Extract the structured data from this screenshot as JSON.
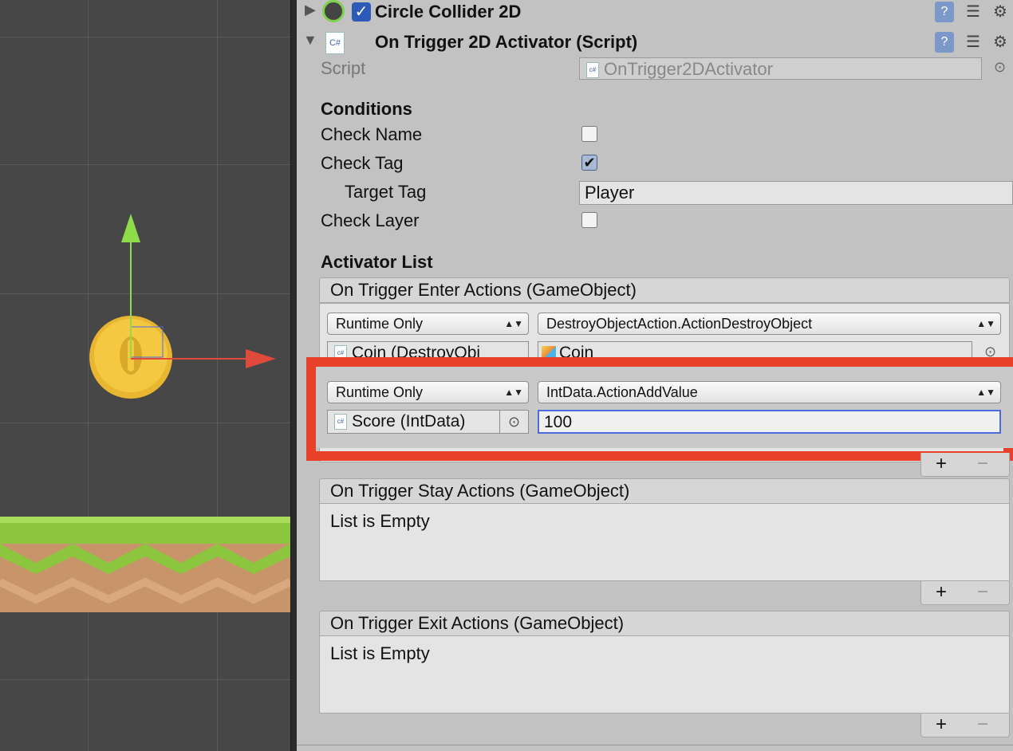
{
  "components": {
    "circle_collider": {
      "title": "Circle Collider 2D"
    },
    "script_component": {
      "title": "On Trigger 2D Activator (Script)",
      "badge": "C#"
    }
  },
  "script_row": {
    "label": "Script",
    "value": "OnTrigger2DActivator"
  },
  "conditions": {
    "header": "Conditions",
    "check_name": {
      "label": "Check Name",
      "checked": false
    },
    "check_tag": {
      "label": "Check Tag",
      "checked": true
    },
    "target_tag": {
      "label": "Target Tag",
      "value": "Player"
    },
    "check_layer": {
      "label": "Check Layer",
      "checked": false
    }
  },
  "activator_list": {
    "header": "Activator List",
    "enter": {
      "title": "On Trigger Enter Actions (GameObject)",
      "items": [
        {
          "mode": "Runtime Only",
          "method": "DestroyObjectAction.ActionDestroyObject",
          "target": "Coin (DestroyObj",
          "arg": "Coin"
        },
        {
          "mode": "Runtime Only",
          "method": "IntData.ActionAddValue",
          "target": "Score (IntData)",
          "arg": "100"
        }
      ]
    },
    "stay": {
      "title": "On Trigger Stay Actions (GameObject)",
      "empty_text": "List is Empty"
    },
    "exit": {
      "title": "On Trigger Exit Actions (GameObject)",
      "empty_text": "List is Empty"
    }
  },
  "buttons": {
    "add": "+",
    "remove": "−"
  },
  "icons": {
    "help": "help-icon",
    "presets": "presets-icon",
    "settings": "gear-icon",
    "object_picker": "object-picker-icon"
  },
  "colors": {
    "highlight": "#e8412a",
    "coin": "#f5c842",
    "grass": "#8cc63f",
    "dirt": "#c8946a"
  }
}
